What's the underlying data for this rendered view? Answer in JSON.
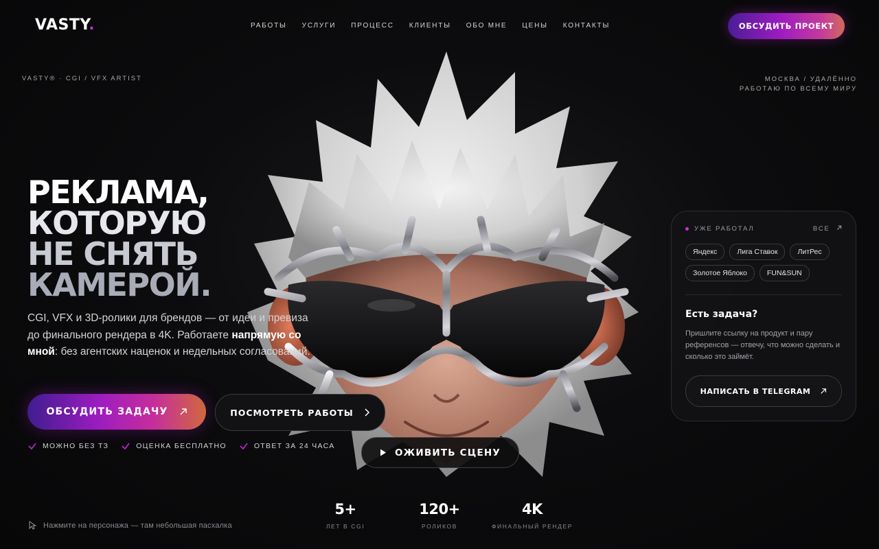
{
  "header": {
    "logo": "VASTY",
    "logo_dot": ".",
    "nav": [
      "РАБОТЫ",
      "УСЛУГИ",
      "ПРОЦЕСС",
      "КЛИЕНТЫ",
      "ОБО МНЕ",
      "ЦЕНЫ",
      "КОНТАКТЫ"
    ],
    "cta": "ОБСУДИТЬ ПРОЕКТ"
  },
  "meta": {
    "left": "VASTY® · CGI / VFX ARTIST",
    "right_line1": "МОСКВА / УДАЛЁННО",
    "right_line2": "РАБОТАЮ ПО ВСЕМУ МИРУ"
  },
  "hero": {
    "headline": [
      "РЕКЛАМА,",
      "КОТОРУЮ",
      "НЕ СНЯТЬ",
      "КАМЕРОЙ."
    ],
    "lead_part1": "CGI, VFX и 3D-ролики для брендов — от идеи и превиза до финального рендера в 4K. Работаете ",
    "lead_bold": "напрямую со мной",
    "lead_part2": ": без агентских наценок и недельных согласований.",
    "primary_button": "ОБСУДИТЬ ЗАДАЧУ",
    "secondary_button": "ПОСМОТРЕТЬ РАБОТЫ",
    "checks": [
      "МОЖНО БЕЗ ТЗ",
      "ОЦЕНКА БЕСПЛАТНО",
      "ОТВЕТ ЗА 24 ЧАСА"
    ],
    "animate_button": "ОЖИВИТЬ СЦЕНУ",
    "hint": "Нажмите на персонажа — там небольшая пасхалка"
  },
  "stats": [
    {
      "num": "5+",
      "label": "ЛЕТ В CGI"
    },
    {
      "num": "120+",
      "label": "РОЛИКОВ"
    },
    {
      "num": "4K",
      "label": "ФИНАЛЬНЫЙ РЕНДЕР"
    }
  ],
  "card": {
    "label": "УЖЕ РАБОТАЛ",
    "all_link": "ВСЕ",
    "clients": [
      "Яндекс",
      "Лига Ставок",
      "ЛитРес",
      "Золотое Яблоко",
      "FUN&SUN"
    ],
    "title": "Есть задача?",
    "text": "Пришлите ссылку на продукт и пару референсов — отвечу, что можно сделать и сколько это займёт.",
    "button": "НАПИСАТЬ В TELEGRAM"
  },
  "colors": {
    "accent": "#c026d3",
    "background": "#0b0b0d",
    "gradient_start": "#4a1d96",
    "gradient_end": "#d0683f"
  }
}
